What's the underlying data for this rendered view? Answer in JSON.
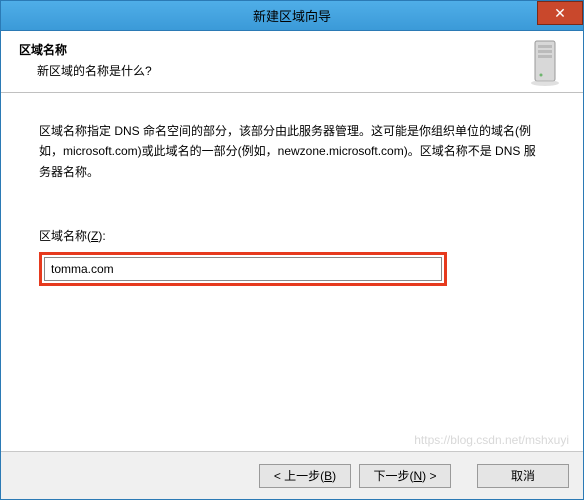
{
  "titlebar": {
    "title": "新建区域向导",
    "close": "✕"
  },
  "header": {
    "title": "区域名称",
    "subtitle": "新区域的名称是什么?"
  },
  "content": {
    "description": "区域名称指定 DNS 命名空间的部分，该部分由此服务器管理。这可能是你组织单位的域名(例如，microsoft.com)或此域名的一部分(例如，newzone.microsoft.com)。区域名称不是 DNS 服务器名称。",
    "field_label_pre": "区域名称(",
    "field_label_key": "Z",
    "field_label_post": "):",
    "field_value": "tomma.com"
  },
  "buttons": {
    "back_pre": "< 上一步(",
    "back_key": "B",
    "back_post": ")",
    "next_pre": "下一步(",
    "next_key": "N",
    "next_post": ") >",
    "cancel": "取消"
  },
  "watermark": "https://blog.csdn.net/mshxuyi"
}
